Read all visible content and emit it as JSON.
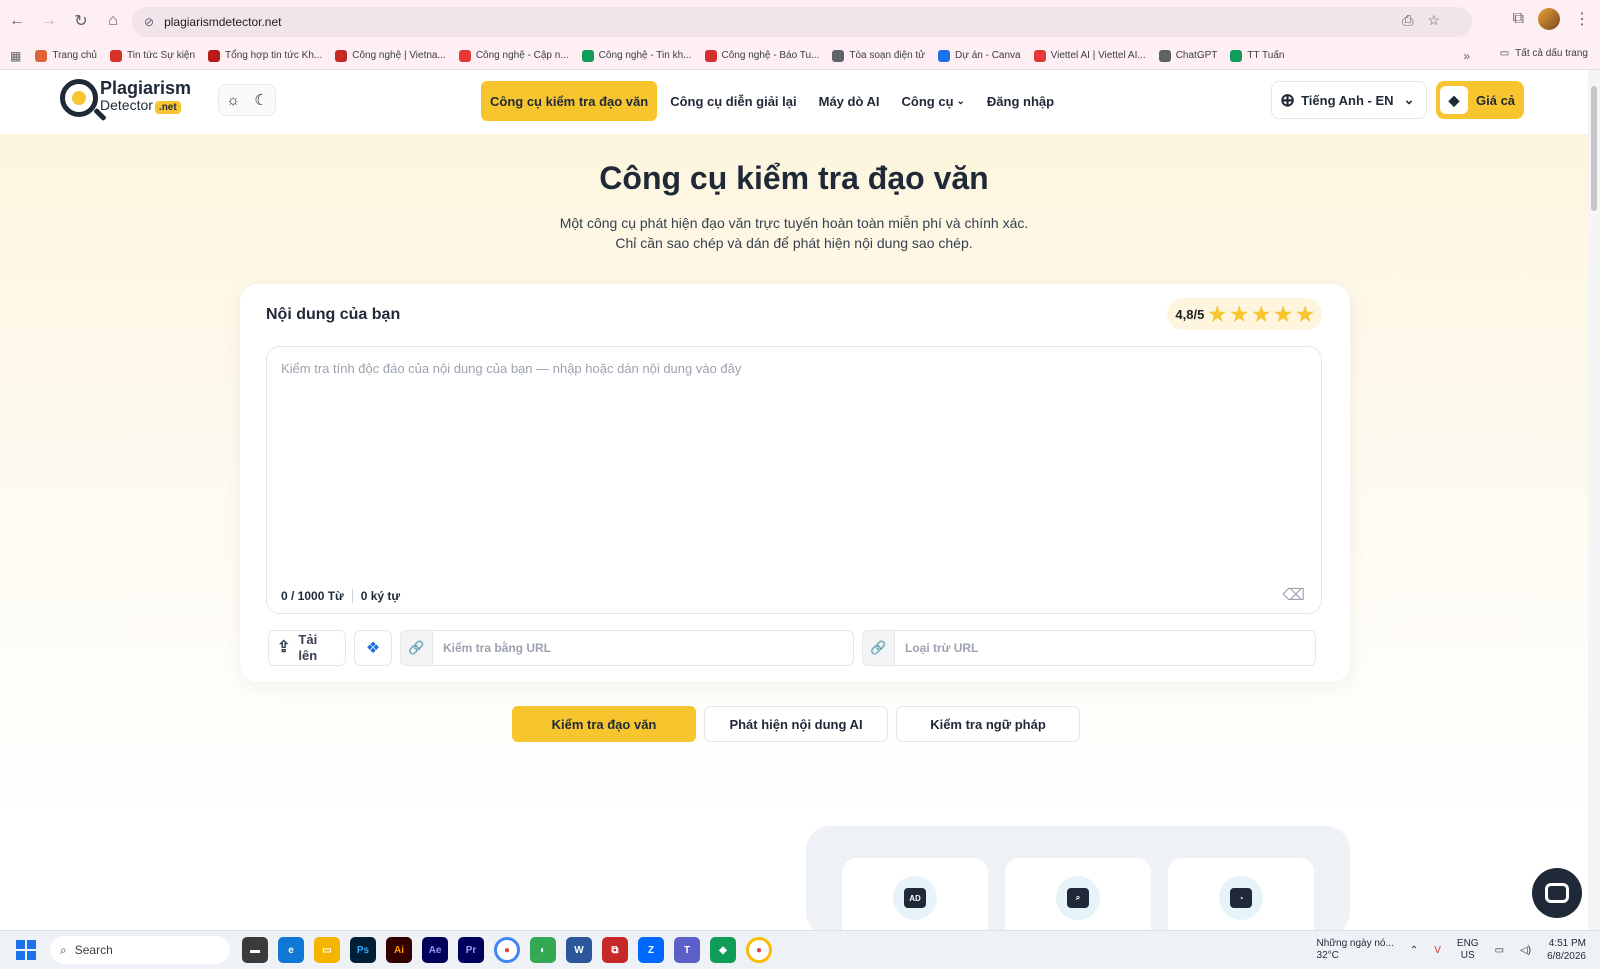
{
  "browser": {
    "url": "plagiarismdetector.net",
    "bookmarks": [
      {
        "label": "Trang chủ",
        "color": "#e0623a"
      },
      {
        "label": "Tin tức Sự kiện",
        "color": "#d93025"
      },
      {
        "label": "Tổng hợp tin tức Kh...",
        "color": "#b71c1c"
      },
      {
        "label": "Công nghệ | Vietna...",
        "color": "#c62828"
      },
      {
        "label": "Công nghệ - Cập n...",
        "color": "#e53935"
      },
      {
        "label": "Công nghệ - Tin kh...",
        "color": "#0f9d58"
      },
      {
        "label": "Công nghệ - Báo Tu...",
        "color": "#d32f2f"
      },
      {
        "label": "Tòa soạn điện tử",
        "color": "#5f6368"
      },
      {
        "label": "Dự án - Canva",
        "color": "#1a73e8"
      },
      {
        "label": "Viettel AI | Viettel AI...",
        "color": "#e53935"
      },
      {
        "label": "ChatGPT",
        "color": "#5f6368"
      },
      {
        "label": "TT Tuấn",
        "color": "#0f9d58"
      }
    ],
    "all_bookmarks": "Tất cả dấu trang"
  },
  "site": {
    "logo_top": "Plagiarism",
    "logo_bottom": "Detector",
    "logo_net": ".net",
    "nav": [
      {
        "label": "Công cụ kiểm tra đạo văn",
        "active": true
      },
      {
        "label": "Công cụ diễn giải lại",
        "active": false
      },
      {
        "label": "Máy dò AI",
        "active": false
      },
      {
        "label": "Công cụ",
        "active": false
      },
      {
        "label": "Đăng nhập",
        "active": false
      }
    ],
    "language": "Tiếng Anh - EN",
    "pricing": "Giá cả"
  },
  "hero": {
    "title": "Công cụ kiểm tra đạo văn",
    "subtitle_line1": "Một công cụ phát hiện đạo văn trực tuyến hoàn toàn miễn phí và chính xác.",
    "subtitle_line2": "Chỉ cần sao chép và dán để phát hiện nội dung sao chép."
  },
  "editor": {
    "title": "Nội dung của bạn",
    "rating": "4,8/5",
    "stars": 5,
    "placeholder": "Kiểm tra tính độc đáo của nội dung của bạn — nhập hoặc dán nội dung vào đây",
    "word_count": "0 / 1000 Từ",
    "char_count": "0 ký tự",
    "upload_label_1": "Tải",
    "upload_label_2": "lên",
    "url_check_placeholder": "Kiểm tra bằng URL",
    "url_exclude_placeholder": "Loại trừ URL"
  },
  "actions": {
    "check_plagiarism": "Kiểm tra đạo văn",
    "detect_ai": "Phát hiện nội dung AI",
    "check_grammar": "Kiểm tra ngữ pháp"
  },
  "features": [
    {
      "icon": "ad-icon",
      "glyph": "AD"
    },
    {
      "icon": "search-window-icon",
      "glyph": "⌕"
    },
    {
      "icon": "document-icon",
      "glyph": "◔"
    }
  ],
  "taskbar": {
    "search": "Search",
    "weather_title": "Những ngày nó...",
    "weather_temp": "32°C",
    "lang_1": "ENG",
    "lang_2": "US",
    "time": "4:51 PM",
    "date": "6/8/2026"
  }
}
